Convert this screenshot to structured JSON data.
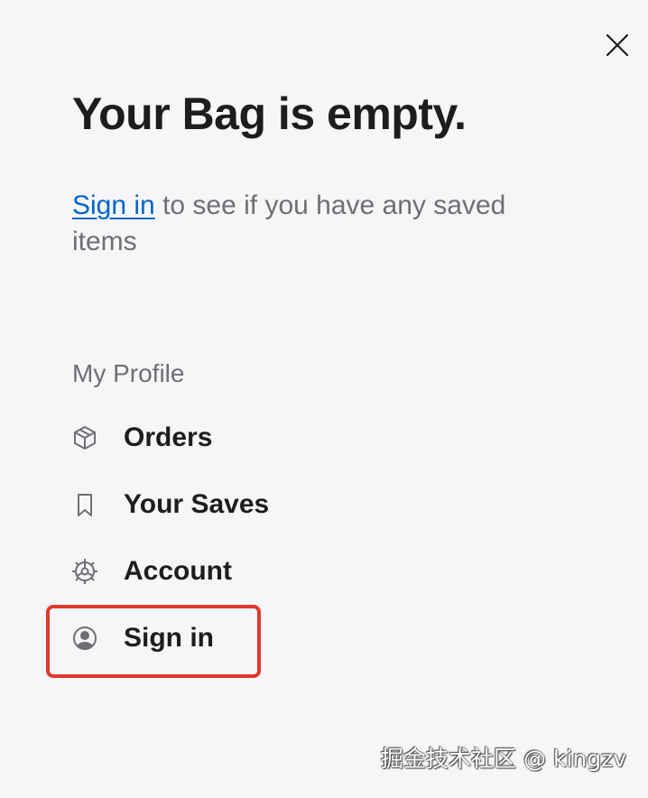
{
  "bag": {
    "title": "Your Bag is empty.",
    "signin_link": "Sign in",
    "signin_message": " to see if you have any saved items",
    "close_icon": "close-icon"
  },
  "profile": {
    "heading": "My Profile",
    "items": [
      {
        "label": "Orders",
        "icon": "box-icon"
      },
      {
        "label": "Your Saves",
        "icon": "bookmark-icon"
      },
      {
        "label": "Account",
        "icon": "gear-icon"
      },
      {
        "label": "Sign in",
        "icon": "person-circle-icon"
      }
    ]
  },
  "annotation": {
    "highlight_color": "#e0382e"
  },
  "watermark": "掘金技术社区 @ kingzv",
  "colors": {
    "link": "#0066cc",
    "text": "#1d1d1f",
    "secondary": "#6e6e73",
    "background": "#f6f6f8"
  }
}
